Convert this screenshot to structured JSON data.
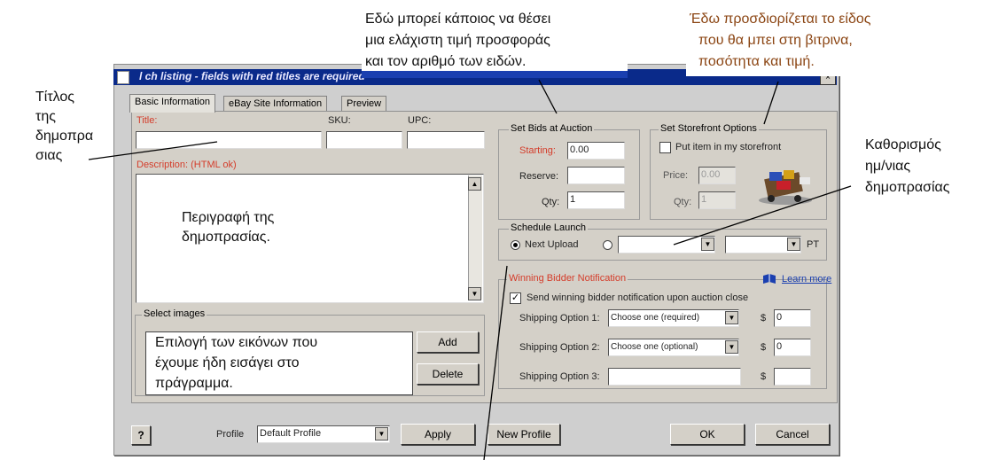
{
  "window": {
    "title": "l      ch listing - fields with red titles are required",
    "close_glyph": "×"
  },
  "tabs": [
    {
      "label": "Basic Information",
      "active": true
    },
    {
      "label": "eBay Site Information",
      "active": false
    },
    {
      "label": "Preview",
      "active": false
    }
  ],
  "basic": {
    "title_label": "Title:",
    "sku_label": "SKU:",
    "upc_label": "UPC:",
    "description_label": "Description: (HTML ok)",
    "select_images_label": "Select images",
    "add_button": "Add",
    "delete_button": "Delete"
  },
  "bids": {
    "group_label": "Set Bids at Auction",
    "starting_label": "Starting:",
    "starting_value": "0.00",
    "reserve_label": "Reserve:",
    "qty_label": "Qty:",
    "qty_value": "1"
  },
  "storefront": {
    "group_label": "Set Storefront Options",
    "put_item_label": "Put item in my storefront",
    "price_label": "Price:",
    "price_value": "0.00",
    "qty_label": "Qty:",
    "qty_value": "1"
  },
  "schedule": {
    "group_label": "Schedule Launch",
    "next_upload_label": "Next Upload",
    "pt_label": "PT"
  },
  "winning": {
    "group_label": "Winning Bidder Notification",
    "learn_more": "Learn more",
    "send_label": "Send winning bidder notification upon auction close",
    "ship1_label": "Shipping Option 1:",
    "ship1_value": "Choose one (required)",
    "ship1_cost": "0",
    "ship2_label": "Shipping Option 2:",
    "ship2_value": "Choose one (optional)",
    "ship2_cost": "0",
    "ship3_label": "Shipping Option 3:",
    "currency": "$"
  },
  "footer": {
    "help_glyph": "?",
    "profile_label": "Profile",
    "profile_value": "Default Profile",
    "apply_button": "Apply",
    "new_profile_button": "New Profile",
    "ok_button": "OK",
    "cancel_button": "Cancel"
  },
  "annotations": {
    "top_center_1": "Εδώ μπορεί κάποιος να θέσει",
    "top_center_2": "μια ελάχιστη τιμή προσφοράς",
    "top_center_3": "και τον αριθμό των ειδών.",
    "top_right_1": "Έδω προσδιορίζεται το είδος",
    "top_right_2": "που θα μπει στη βιτρινα,",
    "top_right_3": "ποσότητα και τιμή.",
    "left_1": "Τίτλος",
    "left_2": "της",
    "left_3": "δημοπρα",
    "left_4": "σιας",
    "right_1": "Καθορισμός",
    "right_2": "ημ/νιας",
    "right_3": "δημοπρασίας",
    "desc_1": "Περιγραφή της",
    "desc_2": "δημοπρασίας.",
    "images_1": "Επιλογή των εικόνων που",
    "images_2": "έχουμε ήδη εισάγει στο",
    "images_3": "πράγραμμα."
  }
}
